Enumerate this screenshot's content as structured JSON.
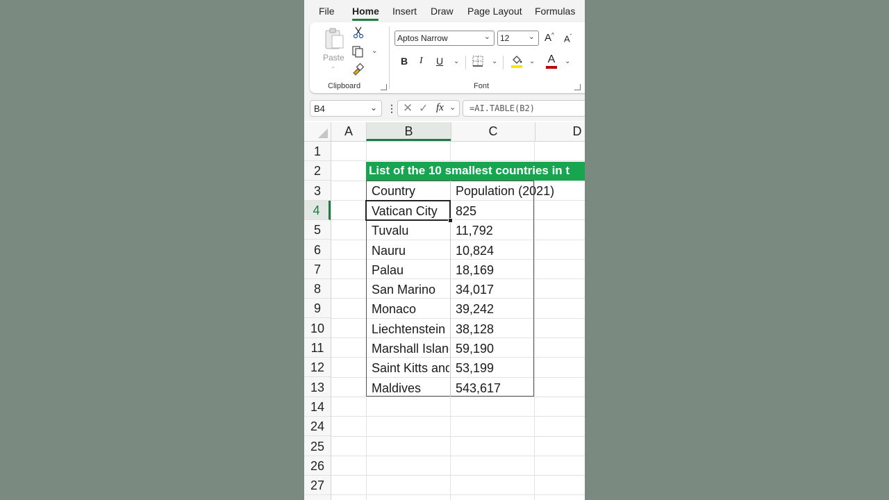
{
  "menu": {
    "tabs": [
      "File",
      "Home",
      "Insert",
      "Draw",
      "Page Layout",
      "Formulas"
    ],
    "active": "Home"
  },
  "ribbon": {
    "clipboard": {
      "paste_label": "Paste",
      "group_label": "Clipboard"
    },
    "font": {
      "name": "Aptos Narrow",
      "size": "12",
      "group_label": "Font",
      "bold": "B",
      "italic": "I",
      "underline": "U",
      "grow": "A",
      "shrink": "A",
      "highlight_color": "#ffe600",
      "font_color": "#c00000"
    }
  },
  "formula_bar": {
    "name_box": "B4",
    "fx": "fx",
    "formula": "=AI.TABLE(B2)"
  },
  "grid": {
    "columns": [
      "A",
      "B",
      "C",
      "D"
    ],
    "selected_column": "B",
    "rows": [
      "1",
      "2",
      "3",
      "4",
      "5",
      "6",
      "7",
      "8",
      "9",
      "10",
      "11",
      "12",
      "13",
      "14",
      "24",
      "25",
      "26",
      "27"
    ],
    "selected_row": "4",
    "title": "List of the 10 smallest countries in t",
    "headers": [
      "Country",
      "Population (2021)"
    ],
    "data": [
      [
        "Vatican City",
        "825"
      ],
      [
        "Tuvalu",
        "11,792"
      ],
      [
        "Nauru",
        "10,824"
      ],
      [
        "Palau",
        "18,169"
      ],
      [
        "San Marino",
        "34,017"
      ],
      [
        "Monaco",
        "39,242"
      ],
      [
        "Liechtenstein",
        "38,128"
      ],
      [
        "Marshall Islands",
        "59,190"
      ],
      [
        "Saint Kitts and Nevis",
        "53,199"
      ],
      [
        "Maldives",
        "543,617"
      ]
    ],
    "accent": "#18a550"
  }
}
